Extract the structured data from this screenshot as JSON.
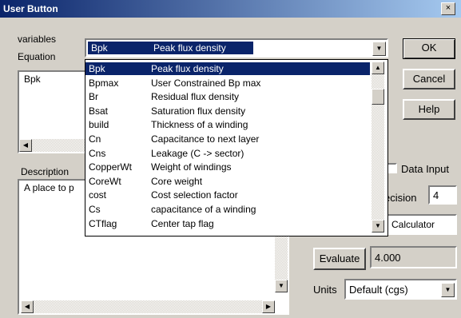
{
  "window": {
    "title": "User Button",
    "close_glyph": "×"
  },
  "variables_label": "variables",
  "equation_label": "Equation",
  "equation_value": "Bpk",
  "description_label": "Description",
  "description_value": "A place to p",
  "combo": {
    "code": "Bpk",
    "desc": "Peak flux density"
  },
  "dropdown_items": [
    {
      "code": "Bpk",
      "desc": "Peak flux density"
    },
    {
      "code": "Bpmax",
      "desc": "User Constrained Bp max"
    },
    {
      "code": "Br",
      "desc": "Residual flux density"
    },
    {
      "code": "Bsat",
      "desc": "Saturation flux density"
    },
    {
      "code": "build",
      "desc": "Thickness of a winding"
    },
    {
      "code": "Cn",
      "desc": "Capacitance to next layer"
    },
    {
      "code": "Cns",
      "desc": "Leakage (C -> sector)"
    },
    {
      "code": "CopperWt",
      "desc": "Weight of windings"
    },
    {
      "code": "CoreWt",
      "desc": "Core weight"
    },
    {
      "code": "cost",
      "desc": "Cost selection factor"
    },
    {
      "code": "Cs",
      "desc": "capacitance of a winding"
    },
    {
      "code": "CTflag",
      "desc": "Center tap flag"
    }
  ],
  "buttons": {
    "ok": "OK",
    "cancel": "Cancel",
    "help": "Help",
    "evaluate": "Evaluate"
  },
  "data_input_label": "Data Input",
  "precision_label": "ecision",
  "precision_value": "4",
  "calculator_label": "Calculator",
  "evaluate_result": "4.000",
  "units_label": "Units",
  "units_value": "Default (cgs)",
  "icons": {
    "down": "▼",
    "up": "▲",
    "left": "◀",
    "right": "▶"
  }
}
